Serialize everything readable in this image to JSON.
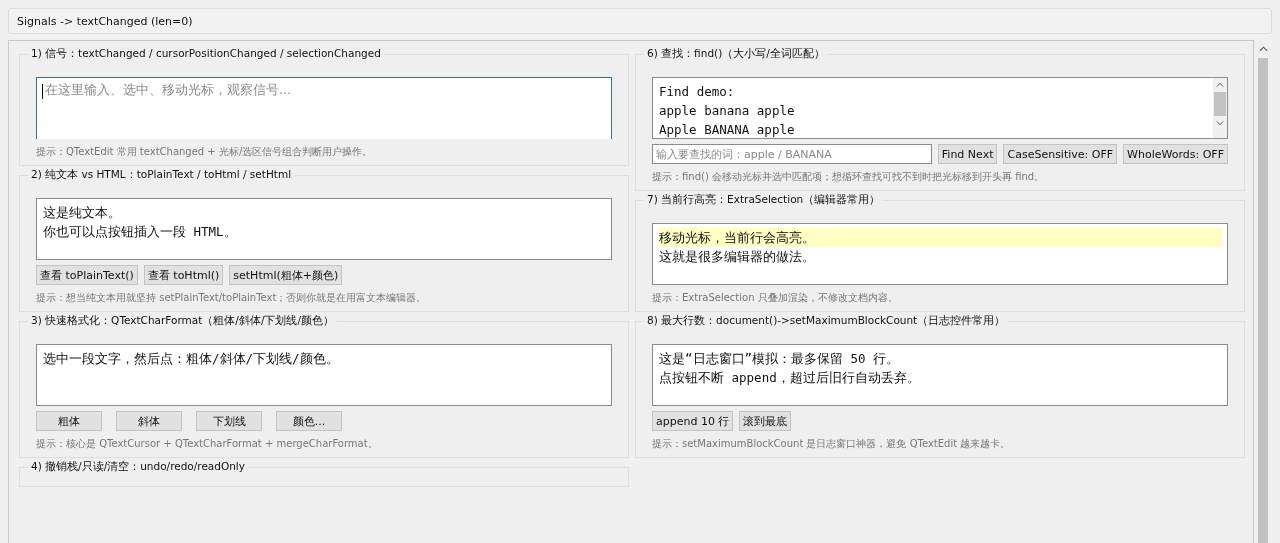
{
  "status_label": "Signals -> textChanged (len=0)",
  "left_column": [
    {
      "title": "1) 信号：textChanged / cursorPositionChanged / selectionChanged",
      "editor": {
        "focused": true,
        "placeholder": "在这里输入、选中、移动光标，观察信号..."
      },
      "hint": "提示：QTextEdit 常用 textChanged + 光标/选区信号组合判断用户操作。"
    },
    {
      "title": "2) 纯文本 vs HTML：toPlainText / toHtml / setHtml",
      "editor": {
        "focused": false,
        "lines": [
          {
            "text": "这是纯文本。",
            "highlighted": false
          },
          {
            "text": "你也可以点按钮插入一段 HTML。",
            "highlighted": false
          }
        ]
      },
      "buttons": {
        "kind": "compact",
        "labels": [
          "查看 toPlainText()",
          "查看 toHtml()",
          "setHtml(粗体+颜色)"
        ]
      },
      "hint": "提示：想当纯文本用就坚持 setPlainText/toPlainText；否则你就是在用富文本编辑器。"
    },
    {
      "title": "3) 快速格式化：QTextCharFormat（粗体/斜体/下划线/颜色）",
      "editor": {
        "focused": false,
        "lines": [
          {
            "text": "选中一段文字，然后点：粗体/斜体/下划线/颜色。",
            "highlighted": false
          }
        ]
      },
      "buttons": {
        "kind": "wide",
        "labels": [
          "粗体",
          "斜体",
          "下划线",
          "颜色..."
        ]
      },
      "hint": "提示：核心是 QTextCursor + QTextCharFormat + mergeCharFormat。"
    },
    {
      "title": "4) 撤销栈/只读/清空：undo/redo/readOnly"
    }
  ],
  "right_column": [
    {
      "title": "6) 查找：find()（大小写/全词匹配）",
      "editor": {
        "focused": false,
        "scrollbar": true,
        "lines": [
          {
            "text": "Find demo:",
            "highlighted": false
          },
          {
            "text": "apple banana apple",
            "highlighted": false
          },
          {
            "text": "Apple BANANA apple",
            "highlighted": false
          }
        ]
      },
      "search": {
        "placeholder": "输入要查找的词：apple / BANANA",
        "buttons": [
          "Find Next",
          "CaseSensitive: OFF",
          "WholeWords: OFF"
        ]
      },
      "hint": "提示：find() 会移动光标并选中匹配项；想循环查找可找不到时把光标移到开头再 find。"
    },
    {
      "title": "7) 当前行高亮：ExtraSelection（编辑器常用）",
      "editor": {
        "focused": false,
        "lines": [
          {
            "text": "移动光标，当前行会高亮。",
            "highlighted": true
          },
          {
            "text": "这就是很多编辑器的做法。",
            "highlighted": false
          }
        ]
      },
      "hint": "提示：ExtraSelection 只叠加渲染，不修改文档内容。"
    },
    {
      "title": "8) 最大行数：document()->setMaximumBlockCount（日志控件常用）",
      "editor": {
        "focused": false,
        "lines": [
          {
            "text": "这是“日志窗口”模拟：最多保留 50 行。",
            "highlighted": false
          },
          {
            "text": "点按钮不断 append，超过后旧行自动丢弃。",
            "highlighted": false
          }
        ]
      },
      "buttons": {
        "kind": "compact",
        "labels": [
          "append 10 行",
          "滚到最底"
        ]
      },
      "hint": "提示：setMaximumBlockCount 是日志窗口神器，避免 QTextEdit 越来越卡。"
    }
  ]
}
